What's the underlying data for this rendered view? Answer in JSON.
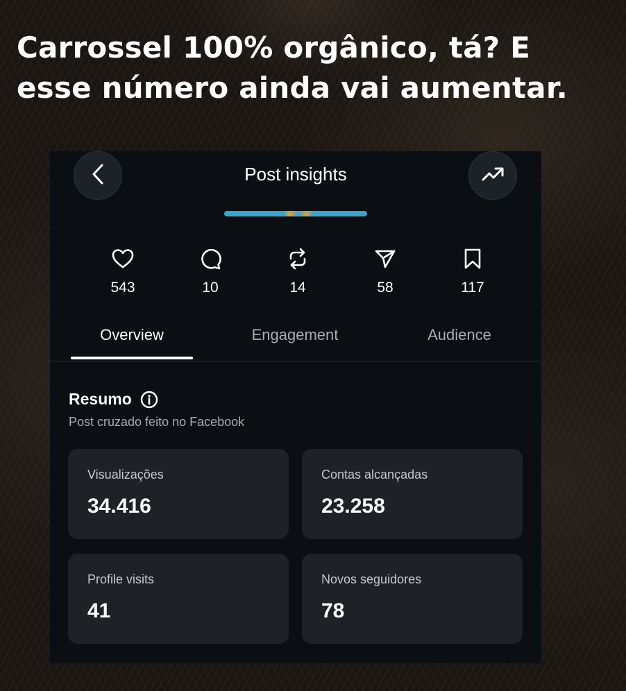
{
  "headline": {
    "line1": "Carrossel 100% orgânico, tá? E",
    "line2": "esse número ainda vai aumentar."
  },
  "header": {
    "title": "Post insights",
    "back_icon": "chevron-left-icon",
    "trend_icon": "trending-up-icon"
  },
  "stats": [
    {
      "icon": "heart-icon",
      "value": "543"
    },
    {
      "icon": "comment-icon",
      "value": "10"
    },
    {
      "icon": "repost-icon",
      "value": "14"
    },
    {
      "icon": "share-icon",
      "value": "58"
    },
    {
      "icon": "bookmark-icon",
      "value": "117"
    }
  ],
  "tabs": [
    {
      "label": "Overview",
      "active": true
    },
    {
      "label": "Engagement",
      "active": false
    },
    {
      "label": "Audience",
      "active": false
    }
  ],
  "summary": {
    "title": "Resumo",
    "info_icon": "info-icon",
    "subtitle": "Post cruzado feito no Facebook"
  },
  "cards": [
    {
      "label": "Visualizações",
      "value": "34.416"
    },
    {
      "label": "Contas alcançadas",
      "value": "23.258"
    },
    {
      "label": "Profile visits",
      "value": "41"
    },
    {
      "label": "Novos seguidores",
      "value": "78"
    }
  ],
  "colors": {
    "panel_background": "#0b0f14",
    "card_background": "#1e2227",
    "muted_text": "#a8adb3",
    "thumbnail_accent": "#3ea3c9"
  }
}
